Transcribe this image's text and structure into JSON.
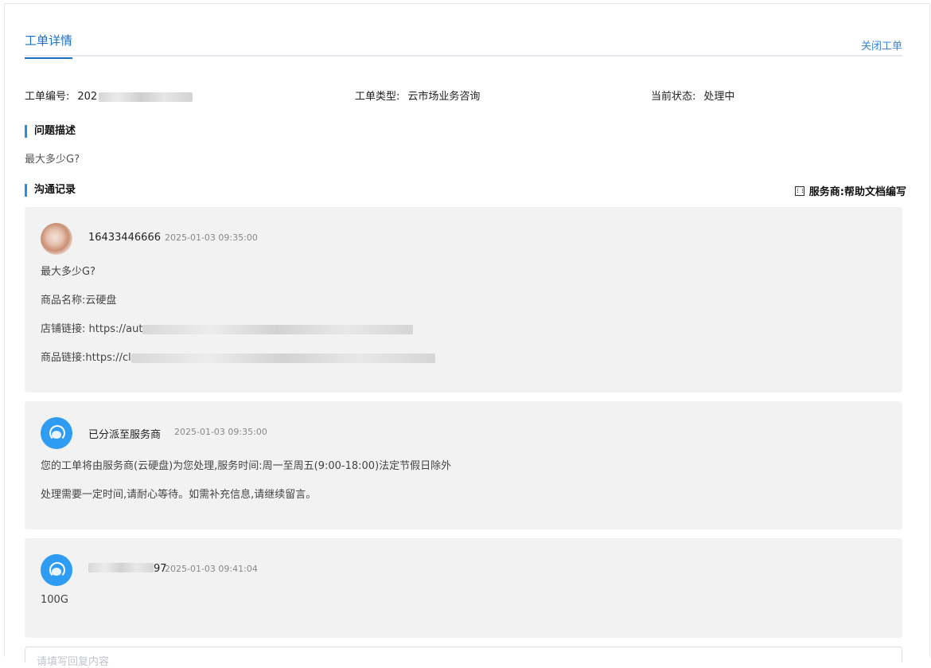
{
  "tabs": {
    "active": "工单详情",
    "close_link": "关闭工单"
  },
  "info": {
    "ticket_no_label": "工单编号:",
    "ticket_no_visible": "202",
    "type_label": "工单类型:",
    "type_value": "云市场业务咨询",
    "status_label": "当前状态:",
    "status_value": "处理中"
  },
  "problem": {
    "title": "问题描述",
    "text": "最大多少G?"
  },
  "comm": {
    "title": "沟通记录",
    "provider": "服务商:帮助文档编写"
  },
  "messages": [
    {
      "user": "16433446666",
      "time": "2025-01-03 09:35:00",
      "lines": [
        "最大多少G?",
        "商品名称:云硬盘",
        "店铺链接: https://aut",
        "商品链接:https://cl"
      ]
    },
    {
      "user": "已分派至服务商",
      "time": "2025-01-03 09:35:00",
      "lines": [
        "您的工单将由服务商(云硬盘)为您处理,服务时间:周一至周五(9:00-18:00)法定节假日除外",
        "处理需要一定时间,请耐心等待。如需补充信息,请继续留言。"
      ]
    },
    {
      "user": "97",
      "time": "2025-01-03 09:41:04",
      "lines": [
        "100G"
      ]
    }
  ],
  "reply": {
    "placeholder": "请填写回复内容"
  }
}
